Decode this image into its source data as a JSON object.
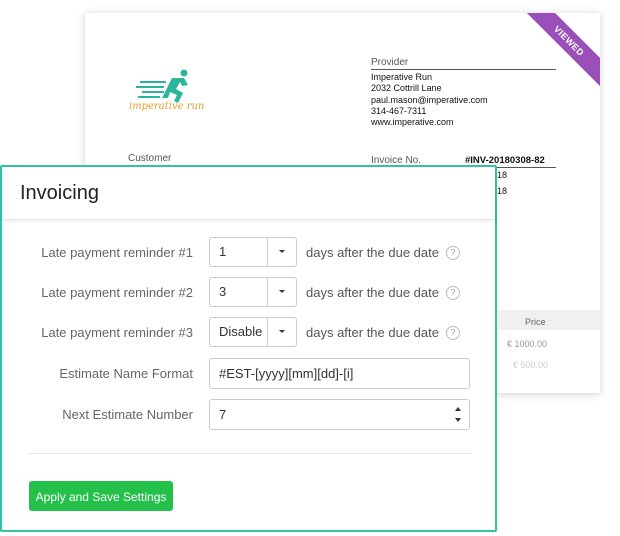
{
  "invoice": {
    "ribbon": "VIEWED",
    "logo_text": "imperative run",
    "provider_label": "Provider",
    "provider_lines": [
      "Imperative Run",
      "2032 Cottrill Lane",
      "paul.mason@imperative.com",
      "314-467-7311",
      "www.imperative.com"
    ],
    "customer_label": "Customer",
    "invoice_no_label": "Invoice No.",
    "invoice_no": "#INV-20180308-82",
    "fragment_1": "18",
    "fragment_2": "18",
    "price_label": "Price",
    "price_1": "€ 1000.00",
    "price_2": "€ 500.00",
    "colors": {
      "ribbon": "#9b4fb8",
      "logo": "#e49b2a",
      "logo_runner": "#2bb59a"
    }
  },
  "panel": {
    "title": "Invoicing",
    "border_color": "#2ec4a5",
    "reminders": [
      {
        "label": "Late payment reminder #1",
        "value": "1",
        "suffix": "days after the due date"
      },
      {
        "label": "Late payment reminder #2",
        "value": "3",
        "suffix": "days after the due date"
      },
      {
        "label": "Late payment reminder #3",
        "value": "Disable",
        "suffix": "days after the due date"
      }
    ],
    "help_glyph": "?",
    "estimate_format": {
      "label": "Estimate Name Format",
      "value": "#EST-[yyyy][mm][dd]-[i]"
    },
    "next_estimate": {
      "label": "Next Estimate Number",
      "value": "7"
    },
    "save_button": {
      "label": "Apply and Save Settings",
      "color": "#23c04a"
    }
  }
}
